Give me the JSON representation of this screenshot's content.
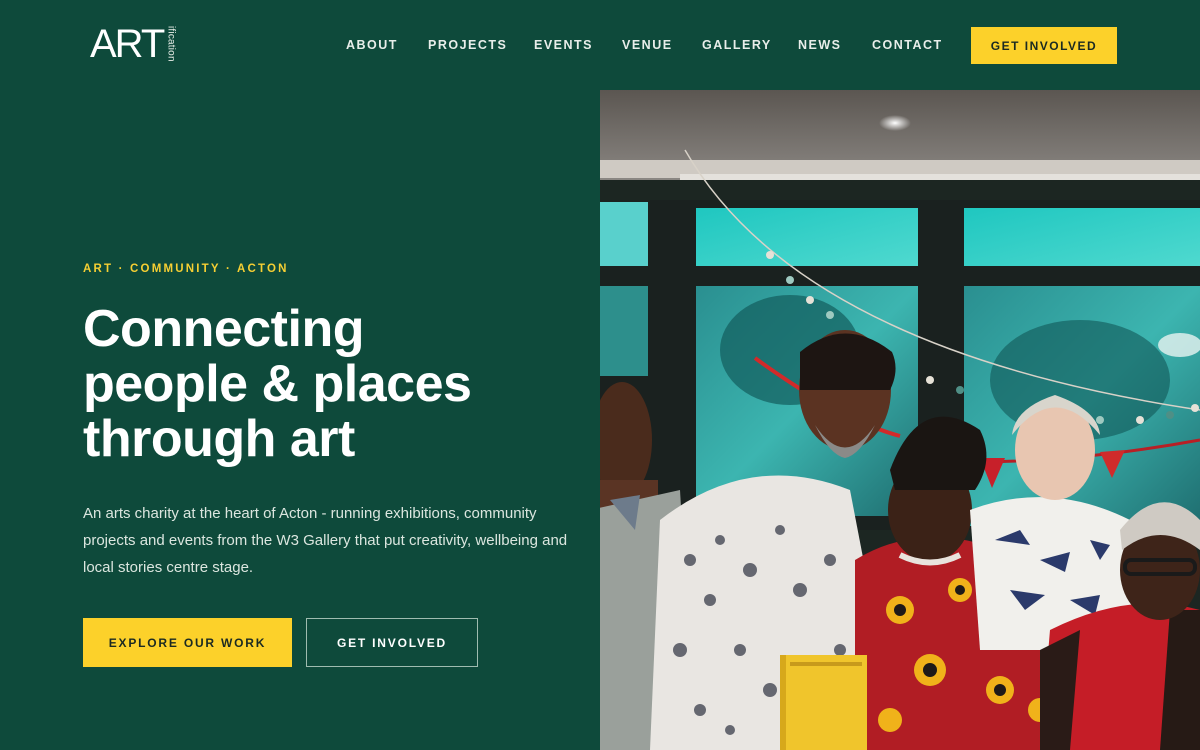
{
  "brand": {
    "logo_main": "ART",
    "logo_vertical": "ification"
  },
  "nav": {
    "items": [
      {
        "label": "ABOUT"
      },
      {
        "label": "PROJECTS"
      },
      {
        "label": "EVENTS"
      },
      {
        "label": "VENUE"
      },
      {
        "label": "GALLERY"
      },
      {
        "label": "NEWS"
      },
      {
        "label": "CONTACT"
      }
    ],
    "cta_label": "GET INVOLVED"
  },
  "hero": {
    "eyebrow": "ART · COMMUNITY · ACTON",
    "headline_line1": "Connecting",
    "headline_line2": "people & places",
    "headline_line3": "through art",
    "lead": "An arts charity at the heart of Acton - running exhibitions, community projects and events from the W3 Gallery that put creativity, wellbeing and local stories centre stage.",
    "primary_button": "EXPLOR E OUR WORK",
    "secondary_button": "GET INVOLVED"
  },
  "colors": {
    "background": "#0e4a3b",
    "accent": "#fcd12a",
    "eyebrow": "#f6cf33"
  }
}
